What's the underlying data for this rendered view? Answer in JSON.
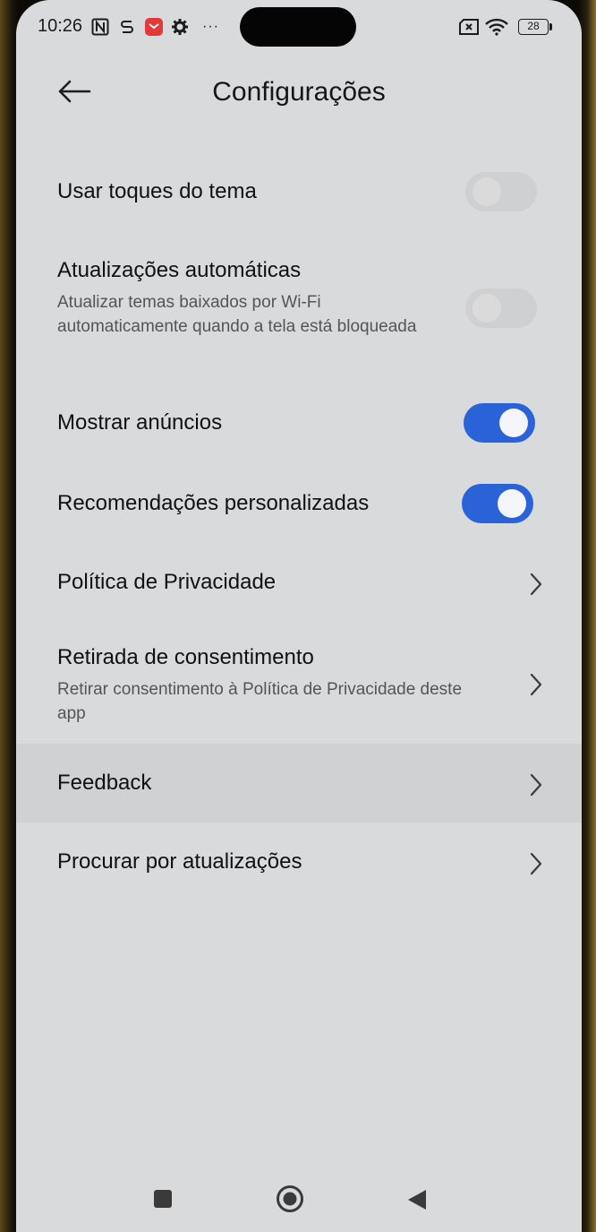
{
  "status_bar": {
    "time": "10:26",
    "battery": "28",
    "icons": [
      "nfc-icon",
      "s-icon",
      "mail-app-icon",
      "settings-icon",
      "more-icon",
      "sim-icon",
      "wifi-icon",
      "battery-icon"
    ],
    "more_label": "···"
  },
  "header": {
    "title": "Configurações",
    "back_icon": "back-arrow-icon"
  },
  "settings": [
    {
      "title": "Usar toques do tema",
      "type": "toggle",
      "state": "off"
    },
    {
      "title": "Atualizações automáticas",
      "subtitle": "Atualizar temas baixados por Wi-Fi automaticamente quando a tela está bloqueada",
      "type": "toggle",
      "state": "off"
    },
    {
      "title": "Mostrar anúncios",
      "type": "toggle",
      "state": "on"
    },
    {
      "title": "Recomendações personalizadas",
      "type": "toggle",
      "state": "on"
    },
    {
      "title": "Política de Privacidade",
      "type": "link"
    },
    {
      "title": "Retirada de consentimento",
      "subtitle": "Retirar consentimento à Política de Privacidade deste app",
      "type": "link"
    },
    {
      "title": "Feedback",
      "type": "link",
      "highlighted": true
    },
    {
      "title": "Procurar por atualizações",
      "type": "link"
    }
  ],
  "nav_bar": {
    "buttons": [
      "recents-square-icon",
      "home-circle-icon",
      "back-triangle-icon"
    ]
  },
  "colors": {
    "accent": "#2a63d8",
    "background": "#d9dadb",
    "text": "#111111"
  }
}
